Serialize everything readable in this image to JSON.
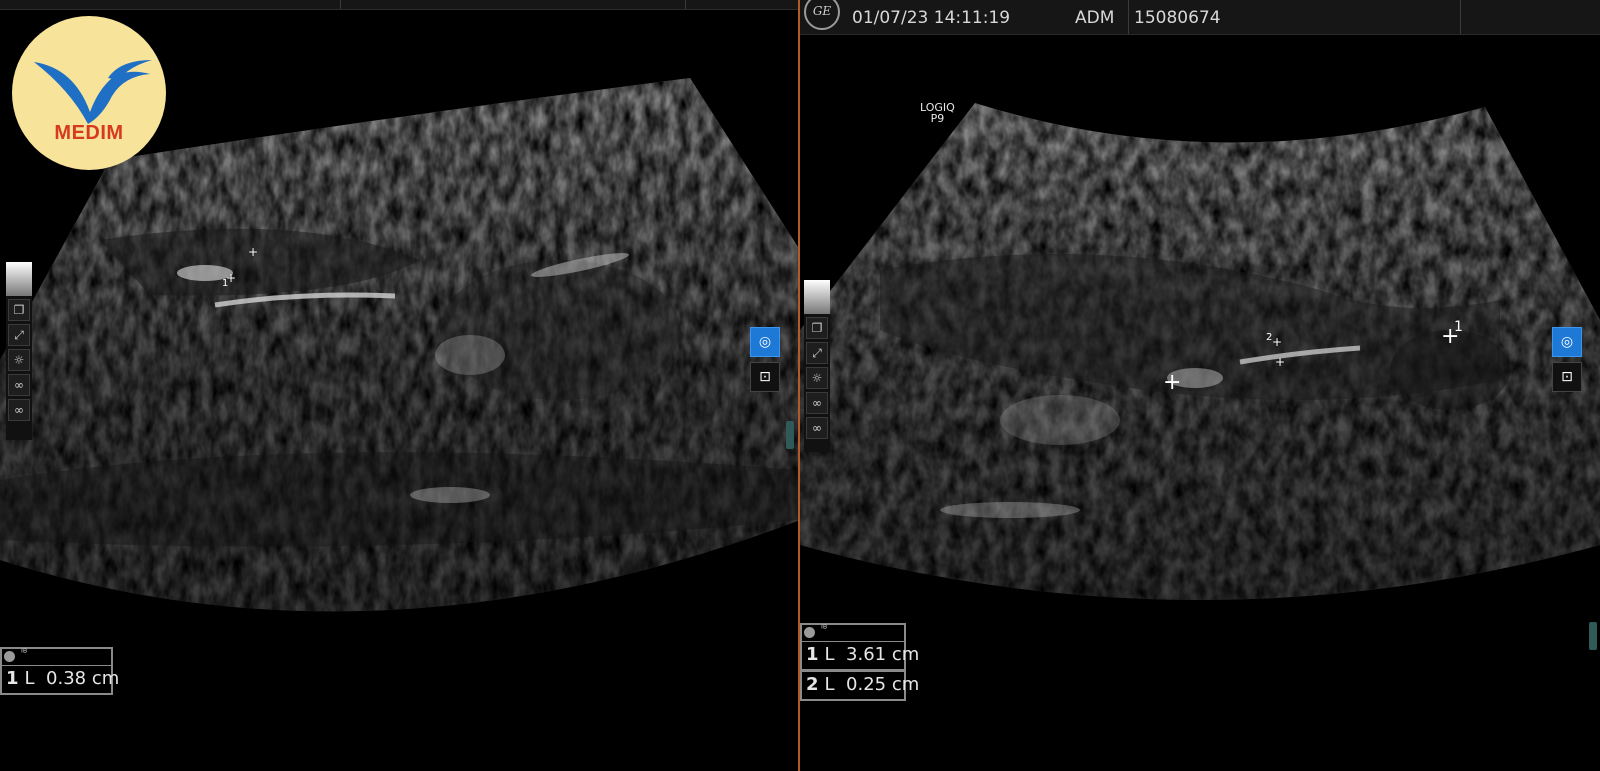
{
  "brand": {
    "logo_text": "MEDIM",
    "colors": {
      "logo_bg": "#f7e39a",
      "logo_bird": "#1f6fc4",
      "logo_text": "#d63a1f",
      "accent_button": "#1d78d6"
    }
  },
  "left_pane": {
    "measurements": [
      {
        "num": "1",
        "type": "L",
        "value": "0.38 cm"
      }
    ],
    "markers": [
      {
        "label": "1"
      }
    ],
    "tools": [
      "copy-icon",
      "fullscreen-icon",
      "brightness-icon",
      "link-icon",
      "link-icon"
    ]
  },
  "right_pane": {
    "header": {
      "datetime": "01/07/23 14:11:19",
      "operator": "ADM",
      "patient_id": "15080674"
    },
    "scanner_label": {
      "line1": "LOGIQ",
      "line2": "P9"
    },
    "measurements": [
      {
        "num": "1",
        "type": "L",
        "value": "3.61 cm"
      },
      {
        "num": "2",
        "type": "L",
        "value": "0.25 cm"
      }
    ],
    "markers": [
      {
        "label": "1"
      },
      {
        "label": "2"
      }
    ],
    "tools": [
      "copy-icon",
      "fullscreen-icon",
      "brightness-icon",
      "link-icon",
      "link-icon"
    ]
  }
}
